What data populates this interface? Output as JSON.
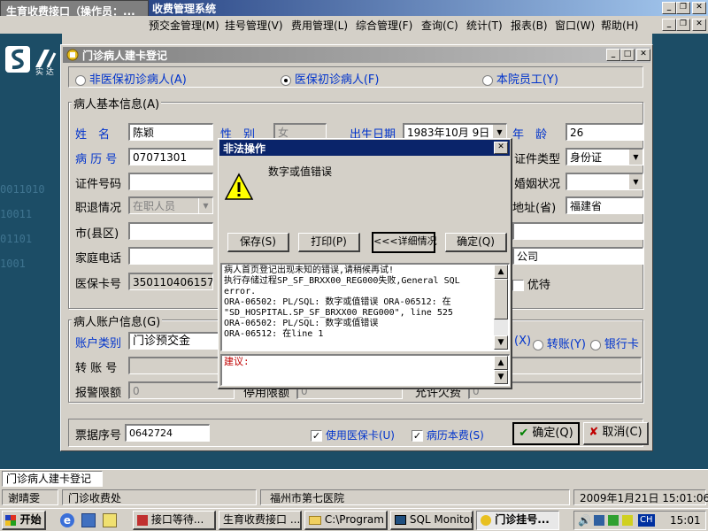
{
  "app": {
    "title_prefix": "生育收费接口（操作员：",
    "title_suffix": "收费管理系统",
    "menu": [
      "预交金管理(M)",
      "挂号管理(V)",
      "费用管理(L)",
      "综合管理(F)",
      "查询(C)",
      "统计(T)",
      "报表(B)",
      "窗口(W)",
      "帮助(H)"
    ],
    "logo_text": "实 达"
  },
  "form": {
    "title": "门诊病人建卡登记",
    "patient_types": [
      {
        "label": "非医保初诊病人(A)",
        "selected": false
      },
      {
        "label": "医保初诊病人(F)",
        "selected": true
      },
      {
        "label": "本院员工(Y)",
        "selected": false
      }
    ],
    "basic_group": "病人基本信息(A)",
    "name_label": "姓　名",
    "name_value": "陈颖",
    "gender_label": "性　别",
    "gender_value": "女",
    "dob_label": "出生日期",
    "dob_value": "1983年10月 9日",
    "age_label": "年　龄",
    "age_value": "26",
    "record_label": "病 历 号",
    "record_value": "07071301",
    "id_type_label": "证件类型",
    "id_type_value": "身份证",
    "id_no_label": "证件号码",
    "id_no_value": "",
    "marital_label": "婚姻状况",
    "marital_value": "",
    "job_label": "职退情况",
    "job_value": "在职人员",
    "province_label": "地址(省)",
    "province_value": "福建省",
    "city_label": "市(县区)",
    "city_value": "",
    "phone_label": "家庭电话",
    "phone_value": "",
    "company_value": "公司",
    "insurance_label": "医保卡号",
    "insurance_value": "350110406157",
    "priority_label": "优待",
    "account_group": "病人账户信息(G)",
    "account_type_label": "账户类别",
    "account_type_value": "门诊预交金",
    "account_options": [
      {
        "label": "(X)"
      },
      {
        "label": "转账(Y)"
      },
      {
        "label": "银行卡"
      }
    ],
    "transfer_label": "转 账 号",
    "transfer_value": "",
    "alarm_label": "报警限额",
    "alarm_value": "0",
    "stop_label": "停用限额",
    "stop_value": "0",
    "allow_label": "允许欠费",
    "allow_value": "0",
    "ticket_label": "票据序号",
    "ticket_value": "0642724",
    "use_insurance_label": "使用医保卡(U)",
    "use_insurance_checked": true,
    "record_fee_label": "病历本费(S)",
    "record_fee_checked": true,
    "ok_label": "确定(Q)",
    "cancel_label": "取消(C)"
  },
  "dialog": {
    "title": "非法操作",
    "message": "数字或值错误",
    "save_label": "保存(S)",
    "print_label": "打印(P)",
    "details_label": "<<<详细情况",
    "ok_label": "确定(Q)",
    "detail_lines": [
      "病人首页登记出现未知的错误,请稍候再试!",
      "执行存储过程SP_SF_BRXX00_REG000失败,General SQL",
      "error.",
      "ORA-06502: PL/SQL: 数字或值错误  ORA-06512: 在",
      "\"SD_HOSPITAL.SP_SF_BRXX00_REG000\", line 525",
      "ORA-06502: PL/SQL: 数字或值错误",
      "ORA-06512: 在line 1"
    ],
    "suggestion_label": "建议:"
  },
  "mdi_tab": "门诊病人建卡登记",
  "status": {
    "user": "谢晴雯",
    "dept": "门诊收费处",
    "hospital": "福州市第七医院",
    "datetime": "2009年1月21日 15:01:06"
  },
  "taskbar": {
    "start": "开始",
    "buttons": [
      "接口等待...",
      "生育收费接口 ...",
      "C:\\Program ...",
      "SQL Monitor",
      "门诊挂号..."
    ],
    "lang": "CH",
    "clock": "15:01"
  },
  "colors": {
    "titlebar": "#0a246a",
    "titlebar_end": "#a6caf0",
    "dialog_title": "#0a246a",
    "label_blue": "#0033cc",
    "desktop_panel": "#1c4d66"
  }
}
